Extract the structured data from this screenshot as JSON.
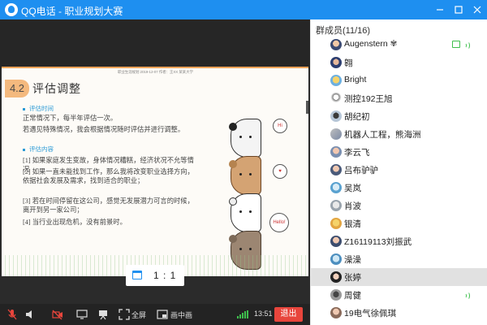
{
  "window": {
    "title": "QQ电话 - 职业规划大赛",
    "controls": [
      "minimize",
      "maximize",
      "close"
    ]
  },
  "slide": {
    "header_text": "职业生涯规划   2019-12-07   作者：王XX 某某大学",
    "section_number": "4.2",
    "section_title": "评估调整",
    "bullets": [
      {
        "label": "评估时间",
        "paragraphs": [
          "正常情况下，每半年评估一次。",
          "若遇见特殊情况，我会根据情况随时评估并进行调整。"
        ]
      },
      {
        "label": "评估内容",
        "paragraphs": [
          "[1] 如果家庭发生变故，身体情况糟糕，经济状况不允等情况",
          "[2] 如果一直未能找到工作，那么我将改变职业选择方向，依据社会发展及需求，找到适合的职业；",
          "[3] 若在时间停留在这公司，感觉无发展潜力可言的时候，离开到另一家公司；",
          "[4] 当行业出现危机，没有前景时。"
        ]
      }
    ],
    "bubble_texts": [
      "Hi",
      "♥",
      "Hello!"
    ]
  },
  "zoom": {
    "label": "1 : 1"
  },
  "toolbar": {
    "fullscreen_label": "全屏",
    "pip_label": "画中画",
    "time": "13:51",
    "exit_label": "退出"
  },
  "members": {
    "header": "群成员(11/16)",
    "list": [
      {
        "name": "Augenstern",
        "suffix_icon": "✾",
        "speaking": true,
        "sharing": true,
        "selected": false
      },
      {
        "name": "翱",
        "speaking": false,
        "sharing": false,
        "selected": false
      },
      {
        "name": "Bright",
        "speaking": false,
        "sharing": false,
        "selected": false
      },
      {
        "name": "测控192王旭",
        "speaking": false,
        "sharing": false,
        "selected": false
      },
      {
        "name": "胡纪初",
        "speaking": false,
        "sharing": false,
        "selected": false
      },
      {
        "name": "机器人工程，熊海洲",
        "speaking": false,
        "sharing": false,
        "selected": false
      },
      {
        "name": "李云飞",
        "speaking": false,
        "sharing": false,
        "selected": false
      },
      {
        "name": "吕布驴驴",
        "speaking": false,
        "sharing": false,
        "selected": false
      },
      {
        "name": "吴岚",
        "speaking": false,
        "sharing": false,
        "selected": false
      },
      {
        "name": "肖波",
        "speaking": false,
        "sharing": false,
        "selected": false
      },
      {
        "name": "银清",
        "speaking": false,
        "sharing": false,
        "selected": false
      },
      {
        "name": "Z16119113刘振武",
        "speaking": false,
        "sharing": false,
        "selected": false
      },
      {
        "name": "澡澡",
        "speaking": false,
        "sharing": false,
        "selected": false
      },
      {
        "name": "张婷",
        "speaking": false,
        "sharing": false,
        "selected": true
      },
      {
        "name": "周健",
        "speaking": true,
        "sharing": false,
        "selected": false
      },
      {
        "name": "19电气徐佩琪",
        "speaking": false,
        "sharing": false,
        "selected": false
      }
    ]
  },
  "colors": {
    "title_bar": "#1e8ff0",
    "exit_button": "#e8453c",
    "speaking_indicator": "#3fbf4d",
    "bullet_label": "#2a9ad6",
    "section_badge": "#f4b97e"
  }
}
